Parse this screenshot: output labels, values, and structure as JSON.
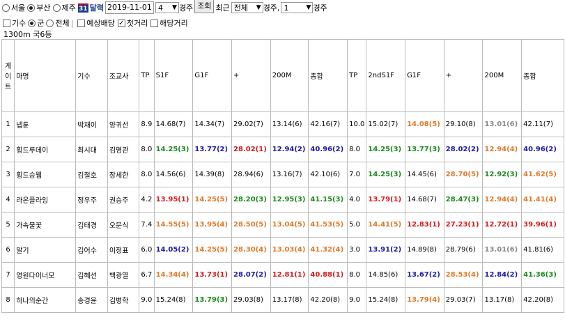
{
  "filters": {
    "regions": [
      {
        "label": "서울",
        "selected": false
      },
      {
        "label": "부산",
        "selected": true
      },
      {
        "label": "제주",
        "selected": false
      }
    ],
    "calendar_icon_text": "31",
    "calendar_label": "달력",
    "date": "2019-11-01",
    "race_no": "4",
    "race_suffix": "경주",
    "lookup_button": "조회",
    "recent_label": "최근",
    "recent_scope": "전체",
    "race_suffix2": "경주,",
    "race_count": "1",
    "race_suffix3": "경주"
  },
  "options": {
    "jockey": {
      "label": "기수",
      "checked": false
    },
    "group": [
      {
        "label": "군",
        "selected": true
      },
      {
        "label": "전체",
        "selected": false
      }
    ],
    "expected_odds": {
      "label": "예상배당",
      "checked": false
    },
    "first_distance": {
      "label": "첫거리",
      "checked": true
    },
    "same_distance": {
      "label": "해당거리",
      "checked": false
    }
  },
  "race_info": "1300m   국6등",
  "table": {
    "headers": [
      "게이트",
      "마명",
      "기수",
      "조교사",
      "TP",
      "S1F",
      "G1F",
      "+",
      "200M",
      "종합",
      "TP",
      "2ndS1F",
      "G1F",
      "+",
      "200M",
      "종합"
    ],
    "rows": [
      {
        "gate": "1",
        "horse": "넵튠",
        "jockey": "박재이",
        "trainer": "양귀선",
        "tp": "8.9",
        "cells": [
          {
            "v": "14.68(7)",
            "c": "black"
          },
          {
            "v": "14.34(7)",
            "c": "black"
          },
          {
            "v": "29.02(7)",
            "c": "black"
          },
          {
            "v": "13.14(6)",
            "c": "black"
          },
          {
            "v": "42.16(7)",
            "c": "black"
          }
        ],
        "tp2": "10.0",
        "cells2": [
          {
            "v": "15.02(7)",
            "c": "black"
          },
          {
            "v": "14.08(5)",
            "c": "orange"
          },
          {
            "v": "29.10(8)",
            "c": "black"
          },
          {
            "v": "13.01(6)",
            "c": "gray"
          },
          {
            "v": "42.11(7)",
            "c": "black"
          }
        ]
      },
      {
        "gate": "2",
        "horse": "횡드루데이",
        "jockey": "최시대",
        "trainer": "김영관",
        "tp": "8.0",
        "cells": [
          {
            "v": "14.25(3)",
            "c": "green"
          },
          {
            "v": "13.77(2)",
            "c": "blue"
          },
          {
            "v": "28.02(1)",
            "c": "red"
          },
          {
            "v": "12.94(2)",
            "c": "blue"
          },
          {
            "v": "40.96(2)",
            "c": "blue"
          }
        ],
        "tp2": "8.0",
        "cells2": [
          {
            "v": "14.25(3)",
            "c": "green"
          },
          {
            "v": "13.77(3)",
            "c": "green"
          },
          {
            "v": "28.02(2)",
            "c": "blue"
          },
          {
            "v": "12.94(4)",
            "c": "orange"
          },
          {
            "v": "40.96(2)",
            "c": "blue"
          }
        ]
      },
      {
        "gate": "3",
        "horse": "횡드승웹",
        "jockey": "김철호",
        "trainer": "장세한",
        "tp": "8.0",
        "cells": [
          {
            "v": "14.56(6)",
            "c": "black"
          },
          {
            "v": "14.39(8)",
            "c": "black"
          },
          {
            "v": "28.94(6)",
            "c": "black"
          },
          {
            "v": "13.16(7)",
            "c": "black"
          },
          {
            "v": "42.10(6)",
            "c": "black"
          }
        ],
        "tp2": "7.0",
        "cells2": [
          {
            "v": "14.25(3)",
            "c": "green"
          },
          {
            "v": "14.45(6)",
            "c": "black"
          },
          {
            "v": "28.70(5)",
            "c": "orange"
          },
          {
            "v": "12.92(3)",
            "c": "green"
          },
          {
            "v": "41.62(5)",
            "c": "orange"
          }
        ]
      },
      {
        "gate": "4",
        "horse": "라온플라잉",
        "jockey": "정우주",
        "trainer": "권승주",
        "tp": "4.2",
        "cells": [
          {
            "v": "13.95(1)",
            "c": "red"
          },
          {
            "v": "14.25(5)",
            "c": "orange"
          },
          {
            "v": "28.20(3)",
            "c": "green"
          },
          {
            "v": "12.95(3)",
            "c": "green"
          },
          {
            "v": "41.15(3)",
            "c": "green"
          }
        ],
        "tp2": "4.0",
        "cells2": [
          {
            "v": "13.79(1)",
            "c": "red"
          },
          {
            "v": "14.68(7)",
            "c": "black"
          },
          {
            "v": "28.47(3)",
            "c": "green"
          },
          {
            "v": "12.94(4)",
            "c": "orange"
          },
          {
            "v": "41.41(4)",
            "c": "orange"
          }
        ]
      },
      {
        "gate": "5",
        "horse": "가속불꽃",
        "jockey": "김태경",
        "trainer": "오문식",
        "tp": "7.4",
        "cells": [
          {
            "v": "14.55(5)",
            "c": "orange"
          },
          {
            "v": "13.95(4)",
            "c": "orange"
          },
          {
            "v": "28.50(5)",
            "c": "orange"
          },
          {
            "v": "13.04(5)",
            "c": "orange"
          },
          {
            "v": "41.53(5)",
            "c": "orange"
          }
        ],
        "tp2": "5.0",
        "cells2": [
          {
            "v": "14.41(5)",
            "c": "orange"
          },
          {
            "v": "12.83(1)",
            "c": "red"
          },
          {
            "v": "27.23(1)",
            "c": "red"
          },
          {
            "v": "12.72(1)",
            "c": "red"
          },
          {
            "v": "39.96(1)",
            "c": "red"
          }
        ]
      },
      {
        "gate": "6",
        "horse": "알기",
        "jockey": "김어수",
        "trainer": "이정표",
        "tp": "6.0",
        "cells": [
          {
            "v": "14.05(2)",
            "c": "blue"
          },
          {
            "v": "14.25(5)",
            "c": "orange"
          },
          {
            "v": "28.30(4)",
            "c": "orange"
          },
          {
            "v": "13.03(4)",
            "c": "orange"
          },
          {
            "v": "41.32(4)",
            "c": "orange"
          }
        ],
        "tp2": "3.0",
        "cells2": [
          {
            "v": "13.91(2)",
            "c": "blue"
          },
          {
            "v": "14.89(8)",
            "c": "black"
          },
          {
            "v": "28.79(6)",
            "c": "black"
          },
          {
            "v": "13.01(6)",
            "c": "gray"
          },
          {
            "v": "41.81(6)",
            "c": "black"
          }
        ]
      },
      {
        "gate": "7",
        "horse": "영원다이너모",
        "jockey": "김혜선",
        "trainer": "백광열",
        "tp": "6.7",
        "cells": [
          {
            "v": "14.34(4)",
            "c": "orange"
          },
          {
            "v": "13.73(1)",
            "c": "red"
          },
          {
            "v": "28.07(2)",
            "c": "blue"
          },
          {
            "v": "12.81(1)",
            "c": "red"
          },
          {
            "v": "40.88(1)",
            "c": "red"
          }
        ],
        "tp2": "8.0",
        "cells2": [
          {
            "v": "14.85(6)",
            "c": "black"
          },
          {
            "v": "13.67(2)",
            "c": "blue"
          },
          {
            "v": "28.53(4)",
            "c": "orange"
          },
          {
            "v": "12.84(2)",
            "c": "blue"
          },
          {
            "v": "41.36(3)",
            "c": "green"
          }
        ]
      },
      {
        "gate": "8",
        "horse": "하나의순간",
        "jockey": "송경윤",
        "trainer": "김병학",
        "tp": "9.0",
        "cells": [
          {
            "v": "15.24(8)",
            "c": "black"
          },
          {
            "v": "13.79(3)",
            "c": "green"
          },
          {
            "v": "29.03(8)",
            "c": "black"
          },
          {
            "v": "13.17(8)",
            "c": "black"
          },
          {
            "v": "42.20(8)",
            "c": "black"
          }
        ],
        "tp2": "9.0",
        "cells2": [
          {
            "v": "15.24(8)",
            "c": "black"
          },
          {
            "v": "13.79(4)",
            "c": "orange"
          },
          {
            "v": "29.03(7)",
            "c": "black"
          },
          {
            "v": "13.17(8)",
            "c": "black"
          },
          {
            "v": "42.20(8)",
            "c": "black"
          }
        ]
      }
    ]
  }
}
